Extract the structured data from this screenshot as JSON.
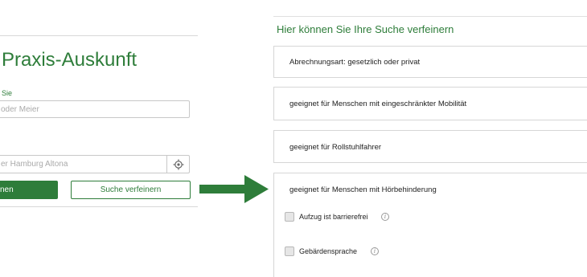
{
  "left": {
    "title": "Praxis-Auskunft",
    "field_label": "Sie",
    "name_placeholder": "oder Meier",
    "location_placeholder": "er Hamburg Altona",
    "search_button": "nen",
    "refine_button": "Suche verfeinern"
  },
  "right": {
    "title": "Hier können Sie Ihre Suche verfeinern",
    "filters": [
      "Abrechnungsart: gesetzlich oder privat",
      "geeignet für Menschen mit eingeschränkter Mobilität",
      "geeignet für Rollstuhlfahrer",
      "geeignet für Menschen mit Hörbehinderung"
    ],
    "checkboxes": [
      "Aufzug ist barrierefrei",
      "Gebärdensprache"
    ],
    "info_glyph": "i"
  },
  "colors": {
    "accent": "#2e7d3a",
    "border": "#d6d6d6",
    "placeholder": "#aaaaaa"
  },
  "icons": [
    "locate-crosshair-icon",
    "right-arrow-icon",
    "info-icon"
  ]
}
